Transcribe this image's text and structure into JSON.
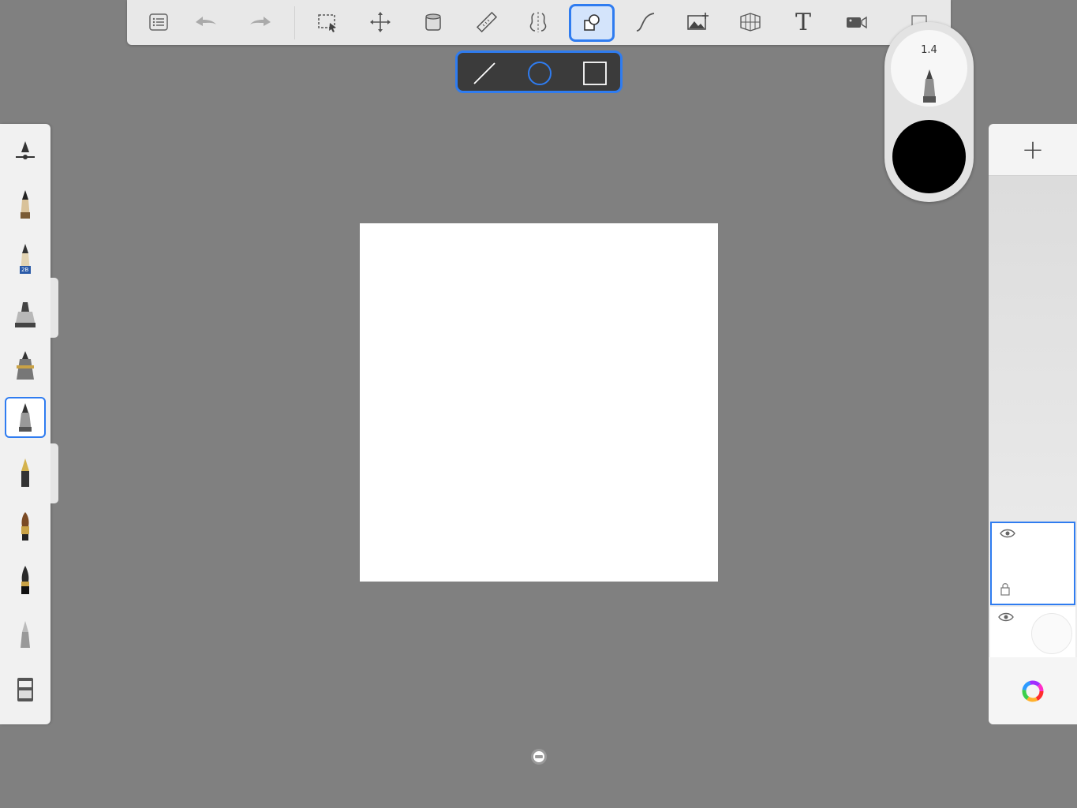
{
  "toolbar": {
    "tools": [
      {
        "icon": "list-icon"
      },
      {
        "icon": "undo-icon"
      },
      {
        "icon": "redo-icon"
      },
      {
        "icon": "selection-icon"
      },
      {
        "icon": "transform-icon"
      },
      {
        "icon": "fill-bucket-icon"
      },
      {
        "icon": "ruler-icon"
      },
      {
        "icon": "symmetry-icon"
      },
      {
        "icon": "shape-icon",
        "active": true
      },
      {
        "icon": "stroke-icon"
      },
      {
        "icon": "import-image-icon"
      },
      {
        "icon": "perspective-icon"
      },
      {
        "icon": "text-icon",
        "label": "T"
      },
      {
        "icon": "record-icon"
      }
    ]
  },
  "shape_popup": {
    "shapes": [
      "line-icon",
      "circle-icon",
      "square-icon"
    ]
  },
  "brush_puck": {
    "size": "1.4",
    "color": "#000000"
  },
  "brushes": [
    "brush-settings-icon",
    "pencil-icon",
    "pencil-2b-icon",
    "marker-icon",
    "ink-pen-icon",
    "ballpoint-icon",
    "fountain-pen-icon",
    "paintbrush-icon",
    "airbrush-icon",
    "smudge-icon",
    "eraser-icon"
  ],
  "brush_badge": "2B",
  "layers": {
    "add_label": "+",
    "items": [
      {
        "active": true,
        "visible": true
      },
      {
        "active": false,
        "visible": true
      }
    ]
  },
  "colors": {
    "accent": "#2f7cf0",
    "background": "#808080",
    "canvas": "#ffffff"
  }
}
